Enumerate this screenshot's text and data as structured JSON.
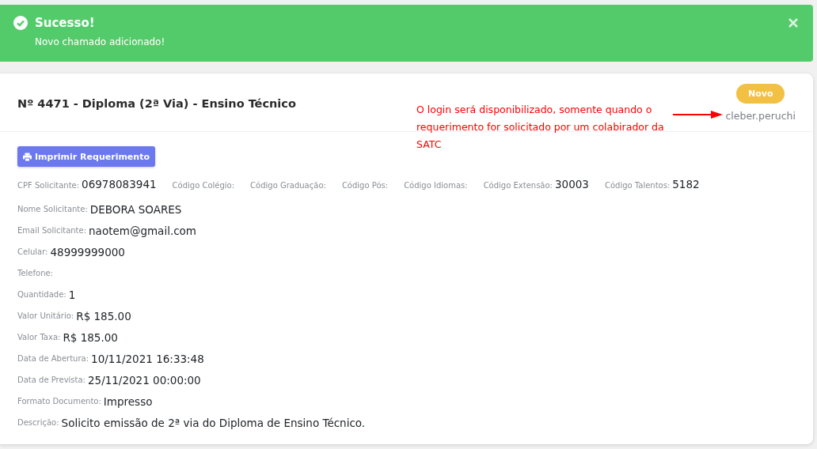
{
  "alert": {
    "title": "Sucesso!",
    "message": "Novo chamado adicionado!",
    "closable": true
  },
  "request": {
    "title": "Nº 4471 - Diploma (2ª Via) - Ensino Técnico",
    "status": "Novo",
    "user": "cleber.peruchi",
    "print_button": "Imprimir Requerimento",
    "codes": [
      {
        "label": "CPF Solicitante:",
        "value": "06978083941"
      },
      {
        "label": "Código Colégio:"
      },
      {
        "label": "Código Graduação:"
      },
      {
        "label": "Código Pós:"
      },
      {
        "label": "Código Idiomas:"
      },
      {
        "label": "Código Extensão:",
        "value": "30003"
      },
      {
        "label": "Código Talentos:",
        "value": "5182"
      }
    ],
    "fields": [
      {
        "label": "Nome Solicitante:",
        "value": "DEBORA SOARES"
      },
      {
        "label": "Email Solicitante:",
        "value": "naotem@gmail.com"
      },
      {
        "label": "Celular:",
        "value": "48999999000"
      },
      {
        "label": "Telefone:"
      },
      {
        "label": "Quantidade:",
        "value": "1"
      },
      {
        "label": "Valor Unitário:",
        "value": "R$ 185.00"
      },
      {
        "label": "Valor Taxa:",
        "value": "R$ 185.00"
      },
      {
        "label": "Data de Abertura:",
        "value": "10/11/2021 16:33:48"
      },
      {
        "label": "Data de Prevista:",
        "value": "25/11/2021 00:00:00"
      },
      {
        "label": "Formato Documento:",
        "value": "Impresso"
      },
      {
        "label": "Descrição:",
        "value": "Solicito emissão de 2ª via do Diploma de Ensino Técnico."
      }
    ]
  },
  "annotation": {
    "text": "O login será disponibilizado, somente quando o requerimento for solicitado por um colabirador da SATC"
  }
}
